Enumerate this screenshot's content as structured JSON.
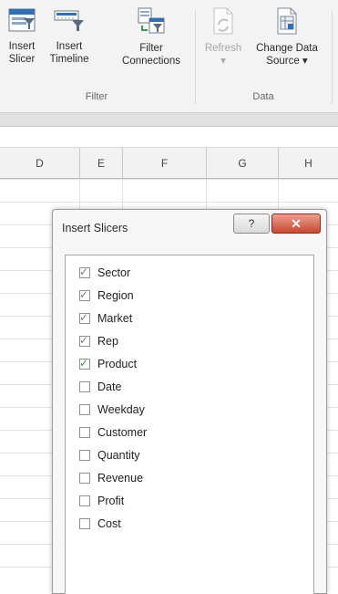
{
  "ribbon": {
    "filter_group": {
      "label": "Filter",
      "buttons": [
        {
          "line1": "Insert",
          "line2": "Slicer",
          "icon": "slicer-icon"
        },
        {
          "line1": "Insert",
          "line2": "Timeline",
          "icon": "timeline-icon"
        },
        {
          "line1": "Filter",
          "line2": "Connections",
          "icon": "filter-connections-icon"
        }
      ]
    },
    "data_group": {
      "label": "Data",
      "buttons": [
        {
          "line1": "Refresh",
          "line2": "▾",
          "icon": "refresh-icon",
          "disabled": true
        },
        {
          "line1": "Change Data",
          "line2": "Source ▾",
          "icon": "change-data-source-icon"
        }
      ]
    }
  },
  "sheet": {
    "columns": [
      "D",
      "E",
      "F",
      "G",
      "H"
    ]
  },
  "dialog": {
    "title": "Insert Slicers",
    "help_label": "?",
    "close_label": "✕",
    "fields": [
      {
        "label": "Sector",
        "checked": true
      },
      {
        "label": "Region",
        "checked": true
      },
      {
        "label": "Market",
        "checked": true
      },
      {
        "label": "Rep",
        "checked": true
      },
      {
        "label": "Product",
        "checked": true
      },
      {
        "label": "Date",
        "checked": false
      },
      {
        "label": "Weekday",
        "checked": false
      },
      {
        "label": "Customer",
        "checked": false
      },
      {
        "label": "Quantity",
        "checked": false
      },
      {
        "label": "Revenue",
        "checked": false
      },
      {
        "label": "Profit",
        "checked": false
      },
      {
        "label": "Cost",
        "checked": false
      }
    ],
    "colors": {
      "checkmark": "#7a7a7a",
      "checkmark_active": "#1f9b3b",
      "close": "#c9482f"
    }
  }
}
